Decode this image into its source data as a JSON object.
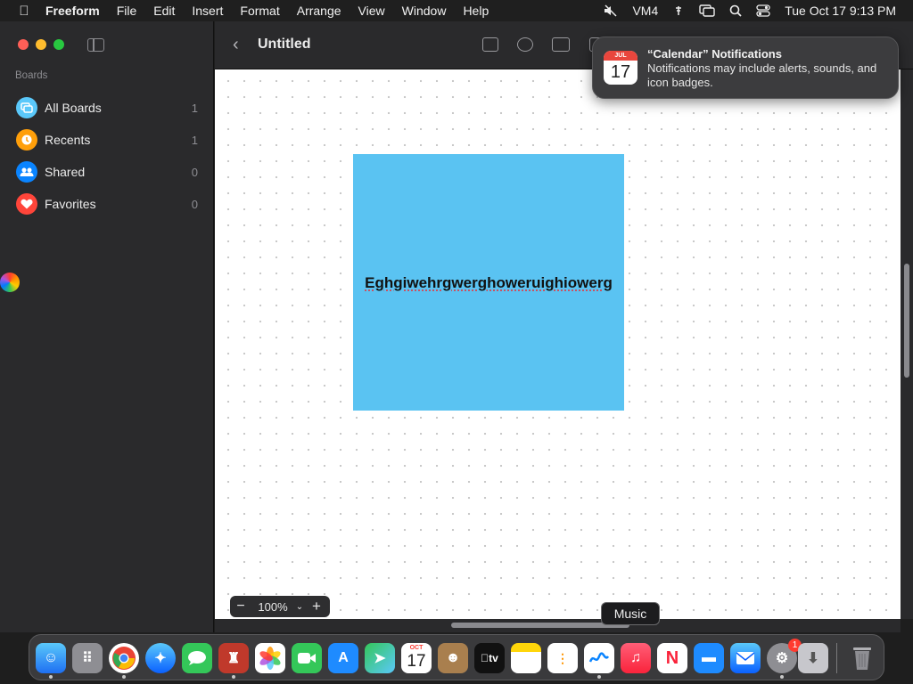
{
  "menubar": {
    "app_name": "Freeform",
    "menus": [
      "File",
      "Edit",
      "Insert",
      "Format",
      "Arrange",
      "View",
      "Window",
      "Help"
    ],
    "vm_label": "VM4",
    "datetime": "Tue Oct 17  9:13 PM"
  },
  "sidebar": {
    "section_title": "Boards",
    "items": [
      {
        "label": "All Boards",
        "count": "1",
        "icon": "boards-icon",
        "color": "#5ac8fa"
      },
      {
        "label": "Recents",
        "count": "1",
        "icon": "clock-icon",
        "color": "#ff9f0a"
      },
      {
        "label": "Shared",
        "count": "0",
        "icon": "people-icon",
        "color": "#0a84ff"
      },
      {
        "label": "Favorites",
        "count": "0",
        "icon": "heart-icon",
        "color": "#ff453a"
      }
    ]
  },
  "toolbar": {
    "title": "Untitled"
  },
  "canvas": {
    "sticky_note": {
      "text": "Eghgiwehrgwerghoweruighiowerg",
      "color": "#5ac3f2"
    },
    "zoom_level": "100%"
  },
  "notification": {
    "icon_month": "JUL",
    "icon_day": "17",
    "title": "“Calendar” Notifications",
    "body": "Notifications may include alerts, sounds, and icon badges."
  },
  "dock": {
    "tooltip": "Music",
    "calendar_month": "OCT",
    "calendar_day": "17",
    "settings_badge": "1"
  }
}
